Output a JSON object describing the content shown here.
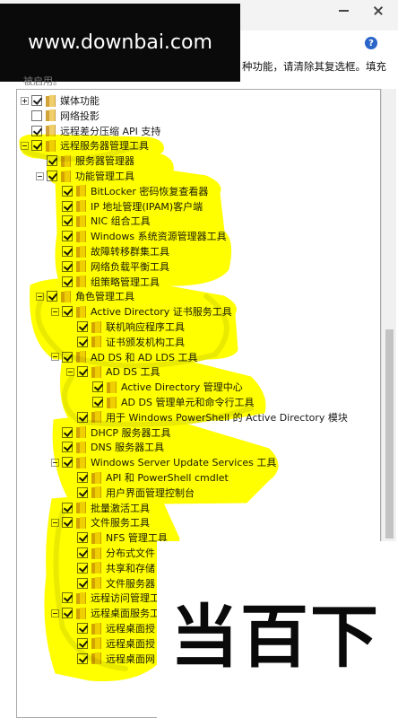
{
  "watermark": "www.downbai.com",
  "window_controls": {
    "minimize": "min-icon",
    "maximize": "max-icon",
    "close": "close-icon"
  },
  "help_icon": "?",
  "description": {
    "line1": "种功能，请清除其复选框。填充",
    "line2": "被启用。"
  },
  "logo_text": "当百下",
  "highlight_color": "#ffff00",
  "tree": [
    {
      "label": "媒体功能",
      "level": 0,
      "expander": "plus",
      "checked": true
    },
    {
      "label": "网络投影",
      "level": 0,
      "expander": "none",
      "checked": false
    },
    {
      "label": "远程差分压缩 API 支持",
      "level": 0,
      "expander": "none",
      "checked": true
    },
    {
      "label": "远程服务器管理工具",
      "level": 0,
      "expander": "minus",
      "checked": true
    },
    {
      "label": "服务器管理器",
      "level": 1,
      "expander": "none",
      "checked": true
    },
    {
      "label": "功能管理工具",
      "level": 1,
      "expander": "minus",
      "checked": true
    },
    {
      "label": "BitLocker 密码恢复查看器",
      "level": 2,
      "expander": "none",
      "checked": true
    },
    {
      "label": "IP 地址管理(IPAM)客户端",
      "level": 2,
      "expander": "none",
      "checked": true
    },
    {
      "label": "NIC 组合工具",
      "level": 2,
      "expander": "none",
      "checked": true
    },
    {
      "label": "Windows 系统资源管理器工具",
      "level": 2,
      "expander": "none",
      "checked": true
    },
    {
      "label": "故障转移群集工具",
      "level": 2,
      "expander": "none",
      "checked": true
    },
    {
      "label": "网络负载平衡工具",
      "level": 2,
      "expander": "none",
      "checked": true
    },
    {
      "label": "组策略管理工具",
      "level": 2,
      "expander": "none",
      "checked": true
    },
    {
      "label": "角色管理工具",
      "level": 1,
      "expander": "minus",
      "checked": true
    },
    {
      "label": "Active Directory 证书服务工具",
      "level": 2,
      "expander": "minus",
      "checked": true
    },
    {
      "label": "联机响应程序工具",
      "level": 3,
      "expander": "none",
      "checked": true
    },
    {
      "label": "证书颁发机构工具",
      "level": 3,
      "expander": "none",
      "checked": true
    },
    {
      "label": "AD DS 和 AD LDS 工具",
      "level": 2,
      "expander": "minus",
      "checked": true
    },
    {
      "label": "AD DS 工具",
      "level": 3,
      "expander": "minus",
      "checked": true
    },
    {
      "label": "Active Directory 管理中心",
      "level": 4,
      "expander": "none",
      "checked": true
    },
    {
      "label": "AD DS 管理单元和命令行工具",
      "level": 4,
      "expander": "none",
      "checked": true
    },
    {
      "label": "用于 Windows PowerShell 的 Active Directory 模块",
      "level": 3,
      "expander": "none",
      "checked": true
    },
    {
      "label": "DHCP 服务器工具",
      "level": 2,
      "expander": "none",
      "checked": true
    },
    {
      "label": "DNS 服务器工具",
      "level": 2,
      "expander": "none",
      "checked": true
    },
    {
      "label": "Windows Server Update Services 工具",
      "level": 2,
      "expander": "minus",
      "checked": true
    },
    {
      "label": "API 和 PowerShell cmdlet",
      "level": 3,
      "expander": "none",
      "checked": true
    },
    {
      "label": "用户界面管理控制台",
      "level": 3,
      "expander": "none",
      "checked": true
    },
    {
      "label": "批量激活工具",
      "level": 2,
      "expander": "none",
      "checked": true
    },
    {
      "label": "文件服务工具",
      "level": 2,
      "expander": "minus",
      "checked": true
    },
    {
      "label": "NFS 管理工具",
      "level": 3,
      "expander": "none",
      "checked": true
    },
    {
      "label": "分布式文件",
      "level": 3,
      "expander": "none",
      "checked": true
    },
    {
      "label": "共享和存储",
      "level": 3,
      "expander": "none",
      "checked": true
    },
    {
      "label": "文件服务器",
      "level": 3,
      "expander": "none",
      "checked": true
    },
    {
      "label": "远程访问管理工",
      "level": 2,
      "expander": "none",
      "checked": true
    },
    {
      "label": "远程桌面服务工",
      "level": 2,
      "expander": "minus",
      "checked": true
    },
    {
      "label": "远程桌面授",
      "level": 3,
      "expander": "none",
      "checked": true
    },
    {
      "label": "远程桌面授",
      "level": 3,
      "expander": "none",
      "checked": true
    },
    {
      "label": "远程桌面网",
      "level": 3,
      "expander": "none",
      "checked": true
    }
  ]
}
